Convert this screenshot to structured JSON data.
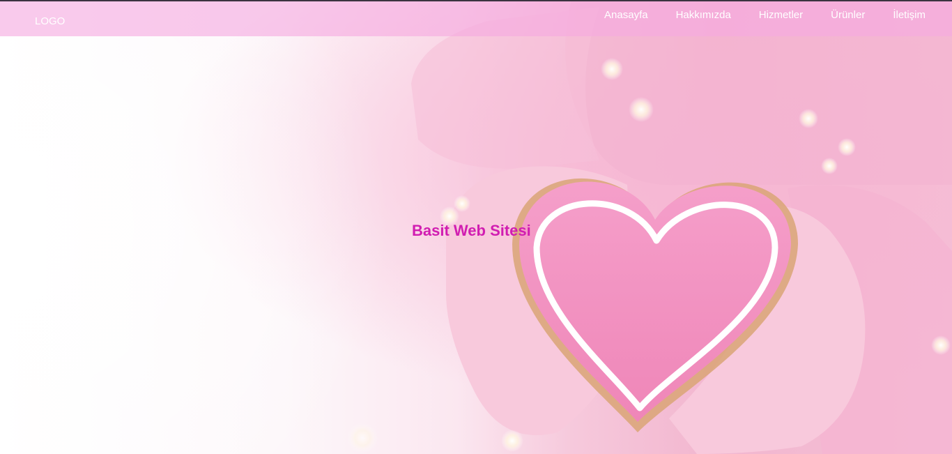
{
  "header": {
    "logo_text": "LOGO",
    "nav_items": [
      {
        "label": "Anasayfa"
      },
      {
        "label": "Hakkımızda"
      },
      {
        "label": "Hizmetler"
      },
      {
        "label": "Ürünler"
      },
      {
        "label": "İletişim"
      }
    ]
  },
  "hero": {
    "title": "Basit Web Sitesi",
    "background_image": "pink-heart-cookie-in-gloved-hands",
    "title_color": "#d11db1",
    "nav_bar_color": "#f5aae1",
    "heart_color": "#f08cbe"
  }
}
